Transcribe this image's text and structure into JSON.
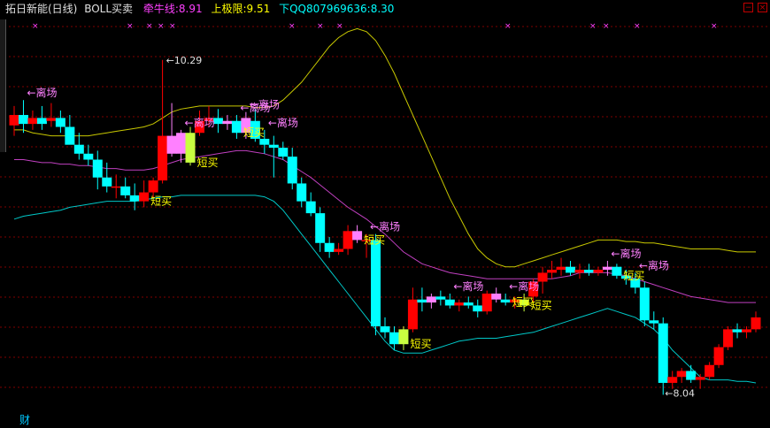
{
  "header": {
    "title": "拓日新能(日线)",
    "indicator_name": "BOLL买卖",
    "mid_label": "牵牛线: ",
    "mid_value": "8.91",
    "upper_label": "上极限: ",
    "upper_value": "9.51",
    "lower_label": "下QQ807969636: ",
    "lower_value": "8.30",
    "colors": {
      "title": "#e0e0e0",
      "indicator": "#e0e0e0",
      "mid": "#ff40ff",
      "upper": "#ffff00",
      "lower": "#00ffff"
    }
  },
  "window_controls": {
    "minimize_icon": "minus-icon",
    "close_icon": "close-icon"
  },
  "bottom_tab": {
    "label": "财"
  },
  "annotations": {
    "high_label": "10.29",
    "low_label": "8.04",
    "exit_label": "离场",
    "short_buy_label": "短买"
  },
  "chart_data": {
    "type": "candlestick",
    "title": "",
    "ylim": [
      7.9,
      10.55
    ],
    "grid": "dotted-horizontal",
    "colors": {
      "up": "#ff0000",
      "down": "#00ffff",
      "upper_band": "#c8c800",
      "mid_band": "#c040c0",
      "lower_band": "#00c8c8",
      "signal_pink": "#ff80ff",
      "signal_yellow": "#c8ff40"
    },
    "candles": [
      {
        "o": 9.85,
        "h": 9.98,
        "l": 9.78,
        "c": 9.92
      },
      {
        "o": 9.92,
        "h": 10.02,
        "l": 9.8,
        "c": 9.86
      },
      {
        "o": 9.86,
        "h": 9.95,
        "l": 9.82,
        "c": 9.9
      },
      {
        "o": 9.9,
        "h": 9.98,
        "l": 9.82,
        "c": 9.86
      },
      {
        "o": 9.88,
        "h": 10.0,
        "l": 9.84,
        "c": 9.9
      },
      {
        "o": 9.9,
        "h": 9.95,
        "l": 9.8,
        "c": 9.84
      },
      {
        "o": 9.84,
        "h": 9.92,
        "l": 9.76,
        "c": 9.72
      },
      {
        "o": 9.72,
        "h": 9.8,
        "l": 9.62,
        "c": 9.66
      },
      {
        "o": 9.66,
        "h": 9.72,
        "l": 9.58,
        "c": 9.62
      },
      {
        "o": 9.62,
        "h": 9.68,
        "l": 9.42,
        "c": 9.5
      },
      {
        "o": 9.5,
        "h": 9.6,
        "l": 9.4,
        "c": 9.44
      },
      {
        "o": 9.44,
        "h": 9.52,
        "l": 9.36,
        "c": 9.44
      },
      {
        "o": 9.44,
        "h": 9.5,
        "l": 9.36,
        "c": 9.38
      },
      {
        "o": 9.38,
        "h": 9.46,
        "l": 9.28,
        "c": 9.34
      },
      {
        "o": 9.34,
        "h": 9.48,
        "l": 9.3,
        "c": 9.4,
        "signal": "short_buy"
      },
      {
        "o": 9.4,
        "h": 9.5,
        "l": 9.36,
        "c": 9.48
      },
      {
        "o": 9.48,
        "h": 10.29,
        "l": 9.46,
        "c": 9.78
      },
      {
        "o": 9.78,
        "h": 10.0,
        "l": 9.64,
        "c": 9.66,
        "fill": "pink"
      },
      {
        "o": 9.66,
        "h": 9.82,
        "l": 9.6,
        "c": 9.8,
        "fill": "pink"
      },
      {
        "o": 9.8,
        "h": 9.84,
        "l": 9.58,
        "c": 9.6,
        "fill": "yellow",
        "signal": "short_buy"
      },
      {
        "o": 9.8,
        "h": 9.95,
        "l": 9.78,
        "c": 9.88
      },
      {
        "o": 9.88,
        "h": 9.98,
        "l": 9.84,
        "c": 9.9
      },
      {
        "o": 9.9,
        "h": 9.96,
        "l": 9.8,
        "c": 9.86
      },
      {
        "o": 9.86,
        "h": 9.92,
        "l": 9.82,
        "c": 9.88,
        "fill": "pink"
      },
      {
        "o": 9.88,
        "h": 9.92,
        "l": 9.76,
        "c": 9.8,
        "signal": "short_buy"
      },
      {
        "o": 9.8,
        "h": 9.94,
        "l": 9.76,
        "c": 9.9,
        "fill": "pink"
      },
      {
        "o": 9.88,
        "h": 9.96,
        "l": 9.74,
        "c": 9.76
      },
      {
        "o": 9.76,
        "h": 9.82,
        "l": 9.66,
        "c": 9.72
      },
      {
        "o": 9.72,
        "h": 9.78,
        "l": 9.5,
        "c": 9.7
      },
      {
        "o": 9.7,
        "h": 9.74,
        "l": 9.62,
        "c": 9.64
      },
      {
        "o": 9.64,
        "h": 9.7,
        "l": 9.42,
        "c": 9.46
      },
      {
        "o": 9.46,
        "h": 9.5,
        "l": 9.3,
        "c": 9.34
      },
      {
        "o": 9.34,
        "h": 9.4,
        "l": 9.24,
        "c": 9.26
      },
      {
        "o": 9.26,
        "h": 9.3,
        "l": 9.0,
        "c": 9.06
      },
      {
        "o": 9.06,
        "h": 9.1,
        "l": 8.96,
        "c": 9.0
      },
      {
        "o": 9.0,
        "h": 9.06,
        "l": 8.98,
        "c": 9.02
      },
      {
        "o": 9.02,
        "h": 9.18,
        "l": 8.98,
        "c": 9.14
      },
      {
        "o": 9.14,
        "h": 9.18,
        "l": 9.06,
        "c": 9.08,
        "fill": "pink",
        "signal": "short_buy"
      },
      {
        "o": 9.08,
        "h": 9.12,
        "l": 8.96,
        "c": 9.08
      },
      {
        "o": 9.08,
        "h": 9.12,
        "l": 8.44,
        "c": 8.5
      },
      {
        "o": 8.5,
        "h": 8.56,
        "l": 8.42,
        "c": 8.46
      },
      {
        "o": 8.46,
        "h": 8.5,
        "l": 8.34,
        "c": 8.38
      },
      {
        "o": 8.38,
        "h": 8.5,
        "l": 8.34,
        "c": 8.48,
        "fill": "yellow",
        "signal": "short_buy"
      },
      {
        "o": 8.48,
        "h": 8.76,
        "l": 8.46,
        "c": 8.68
      },
      {
        "o": 8.68,
        "h": 8.76,
        "l": 8.6,
        "c": 8.66
      },
      {
        "o": 8.66,
        "h": 8.72,
        "l": 8.62,
        "c": 8.7,
        "fill": "pink"
      },
      {
        "o": 8.7,
        "h": 8.74,
        "l": 8.64,
        "c": 8.68
      },
      {
        "o": 8.68,
        "h": 8.72,
        "l": 8.62,
        "c": 8.64
      },
      {
        "o": 8.64,
        "h": 8.68,
        "l": 8.6,
        "c": 8.66
      },
      {
        "o": 8.66,
        "h": 8.7,
        "l": 8.62,
        "c": 8.64
      },
      {
        "o": 8.64,
        "h": 8.68,
        "l": 8.56,
        "c": 8.6
      },
      {
        "o": 8.6,
        "h": 8.74,
        "l": 8.58,
        "c": 8.72
      },
      {
        "o": 8.72,
        "h": 8.76,
        "l": 8.66,
        "c": 8.68,
        "fill": "pink"
      },
      {
        "o": 8.68,
        "h": 8.72,
        "l": 8.64,
        "c": 8.66,
        "signal": "short_buy"
      },
      {
        "o": 8.66,
        "h": 8.7,
        "l": 8.62,
        "c": 8.68
      },
      {
        "o": 8.68,
        "h": 8.72,
        "l": 8.6,
        "c": 8.64,
        "fill": "yellow",
        "signal": "short_buy"
      },
      {
        "o": 8.7,
        "h": 8.82,
        "l": 8.66,
        "c": 8.8
      },
      {
        "o": 8.8,
        "h": 8.9,
        "l": 8.72,
        "c": 8.86
      },
      {
        "o": 8.86,
        "h": 8.94,
        "l": 8.82,
        "c": 8.88
      },
      {
        "o": 8.88,
        "h": 8.96,
        "l": 8.84,
        "c": 8.9
      },
      {
        "o": 8.9,
        "h": 8.94,
        "l": 8.84,
        "c": 8.86
      },
      {
        "o": 8.86,
        "h": 8.92,
        "l": 8.82,
        "c": 8.88
      },
      {
        "o": 8.88,
        "h": 8.92,
        "l": 8.84,
        "c": 8.86
      },
      {
        "o": 8.86,
        "h": 8.9,
        "l": 8.84,
        "c": 8.88
      },
      {
        "o": 8.88,
        "h": 8.94,
        "l": 8.84,
        "c": 8.9,
        "fill": "pink"
      },
      {
        "o": 8.9,
        "h": 8.92,
        "l": 8.82,
        "c": 8.84,
        "signal": "short_buy"
      },
      {
        "o": 8.84,
        "h": 8.88,
        "l": 8.78,
        "c": 8.82
      },
      {
        "o": 8.82,
        "h": 8.86,
        "l": 8.72,
        "c": 8.76
      },
      {
        "o": 8.76,
        "h": 8.8,
        "l": 8.5,
        "c": 8.54
      },
      {
        "o": 8.54,
        "h": 8.6,
        "l": 8.48,
        "c": 8.52
      },
      {
        "o": 8.52,
        "h": 8.56,
        "l": 8.04,
        "c": 8.12
      },
      {
        "o": 8.12,
        "h": 8.2,
        "l": 8.08,
        "c": 8.16
      },
      {
        "o": 8.16,
        "h": 8.22,
        "l": 8.12,
        "c": 8.2
      },
      {
        "o": 8.2,
        "h": 8.24,
        "l": 8.12,
        "c": 8.14
      },
      {
        "o": 8.14,
        "h": 8.18,
        "l": 8.08,
        "c": 8.16
      },
      {
        "o": 8.16,
        "h": 8.26,
        "l": 8.14,
        "c": 8.24
      },
      {
        "o": 8.24,
        "h": 8.38,
        "l": 8.22,
        "c": 8.36
      },
      {
        "o": 8.36,
        "h": 8.5,
        "l": 8.34,
        "c": 8.48
      },
      {
        "o": 8.48,
        "h": 8.52,
        "l": 8.42,
        "c": 8.46
      },
      {
        "o": 8.46,
        "h": 8.5,
        "l": 8.42,
        "c": 8.48
      },
      {
        "o": 8.48,
        "h": 8.6,
        "l": 8.46,
        "c": 8.56
      }
    ],
    "bands": {
      "upper": [
        9.82,
        9.82,
        9.8,
        9.79,
        9.78,
        9.78,
        9.78,
        9.78,
        9.78,
        9.79,
        9.8,
        9.81,
        9.82,
        9.83,
        9.84,
        9.86,
        9.9,
        9.94,
        9.96,
        9.97,
        9.98,
        9.98,
        9.98,
        9.98,
        9.98,
        9.98,
        9.97,
        9.97,
        9.98,
        10.02,
        10.08,
        10.14,
        10.22,
        10.3,
        10.38,
        10.44,
        10.48,
        10.5,
        10.48,
        10.42,
        10.32,
        10.2,
        10.06,
        9.92,
        9.78,
        9.64,
        9.5,
        9.36,
        9.24,
        9.12,
        9.02,
        8.96,
        8.92,
        8.9,
        8.9,
        8.92,
        8.94,
        8.96,
        8.98,
        9.0,
        9.02,
        9.04,
        9.06,
        9.08,
        9.08,
        9.08,
        9.07,
        9.07,
        9.06,
        9.06,
        9.05,
        9.04,
        9.03,
        9.02,
        9.02,
        9.02,
        9.02,
        9.01,
        9.0,
        9.0,
        9.0
      ],
      "mid": [
        9.62,
        9.62,
        9.61,
        9.6,
        9.6,
        9.59,
        9.59,
        9.58,
        9.58,
        9.57,
        9.56,
        9.56,
        9.55,
        9.55,
        9.55,
        9.56,
        9.58,
        9.6,
        9.62,
        9.63,
        9.64,
        9.65,
        9.66,
        9.67,
        9.68,
        9.68,
        9.67,
        9.66,
        9.64,
        9.62,
        9.58,
        9.54,
        9.5,
        9.45,
        9.4,
        9.35,
        9.3,
        9.26,
        9.22,
        9.17,
        9.12,
        9.06,
        9.0,
        8.96,
        8.92,
        8.9,
        8.88,
        8.86,
        8.85,
        8.84,
        8.83,
        8.82,
        8.82,
        8.82,
        8.82,
        8.82,
        8.82,
        8.82,
        8.82,
        8.83,
        8.84,
        8.86,
        8.86,
        8.86,
        8.86,
        8.85,
        8.84,
        8.82,
        8.8,
        8.78,
        8.76,
        8.74,
        8.72,
        8.7,
        8.69,
        8.68,
        8.67,
        8.66,
        8.66,
        8.66,
        8.66
      ],
      "lower": [
        9.22,
        9.24,
        9.25,
        9.26,
        9.27,
        9.28,
        9.3,
        9.31,
        9.32,
        9.33,
        9.34,
        9.34,
        9.34,
        9.34,
        9.35,
        9.36,
        9.37,
        9.37,
        9.38,
        9.38,
        9.38,
        9.38,
        9.38,
        9.38,
        9.38,
        9.38,
        9.38,
        9.37,
        9.34,
        9.28,
        9.2,
        9.12,
        9.04,
        8.96,
        8.88,
        8.8,
        8.72,
        8.64,
        8.56,
        8.48,
        8.4,
        8.34,
        8.32,
        8.32,
        8.32,
        8.34,
        8.36,
        8.38,
        8.4,
        8.41,
        8.42,
        8.42,
        8.42,
        8.43,
        8.44,
        8.45,
        8.46,
        8.48,
        8.5,
        8.52,
        8.54,
        8.56,
        8.58,
        8.6,
        8.62,
        8.6,
        8.58,
        8.56,
        8.52,
        8.48,
        8.42,
        8.34,
        8.28,
        8.22,
        8.16,
        8.14,
        8.14,
        8.14,
        8.13,
        8.13,
        8.12
      ]
    },
    "exit_signal_indices": [
      1,
      18,
      24,
      25,
      27,
      38,
      47,
      53,
      64,
      67
    ]
  }
}
